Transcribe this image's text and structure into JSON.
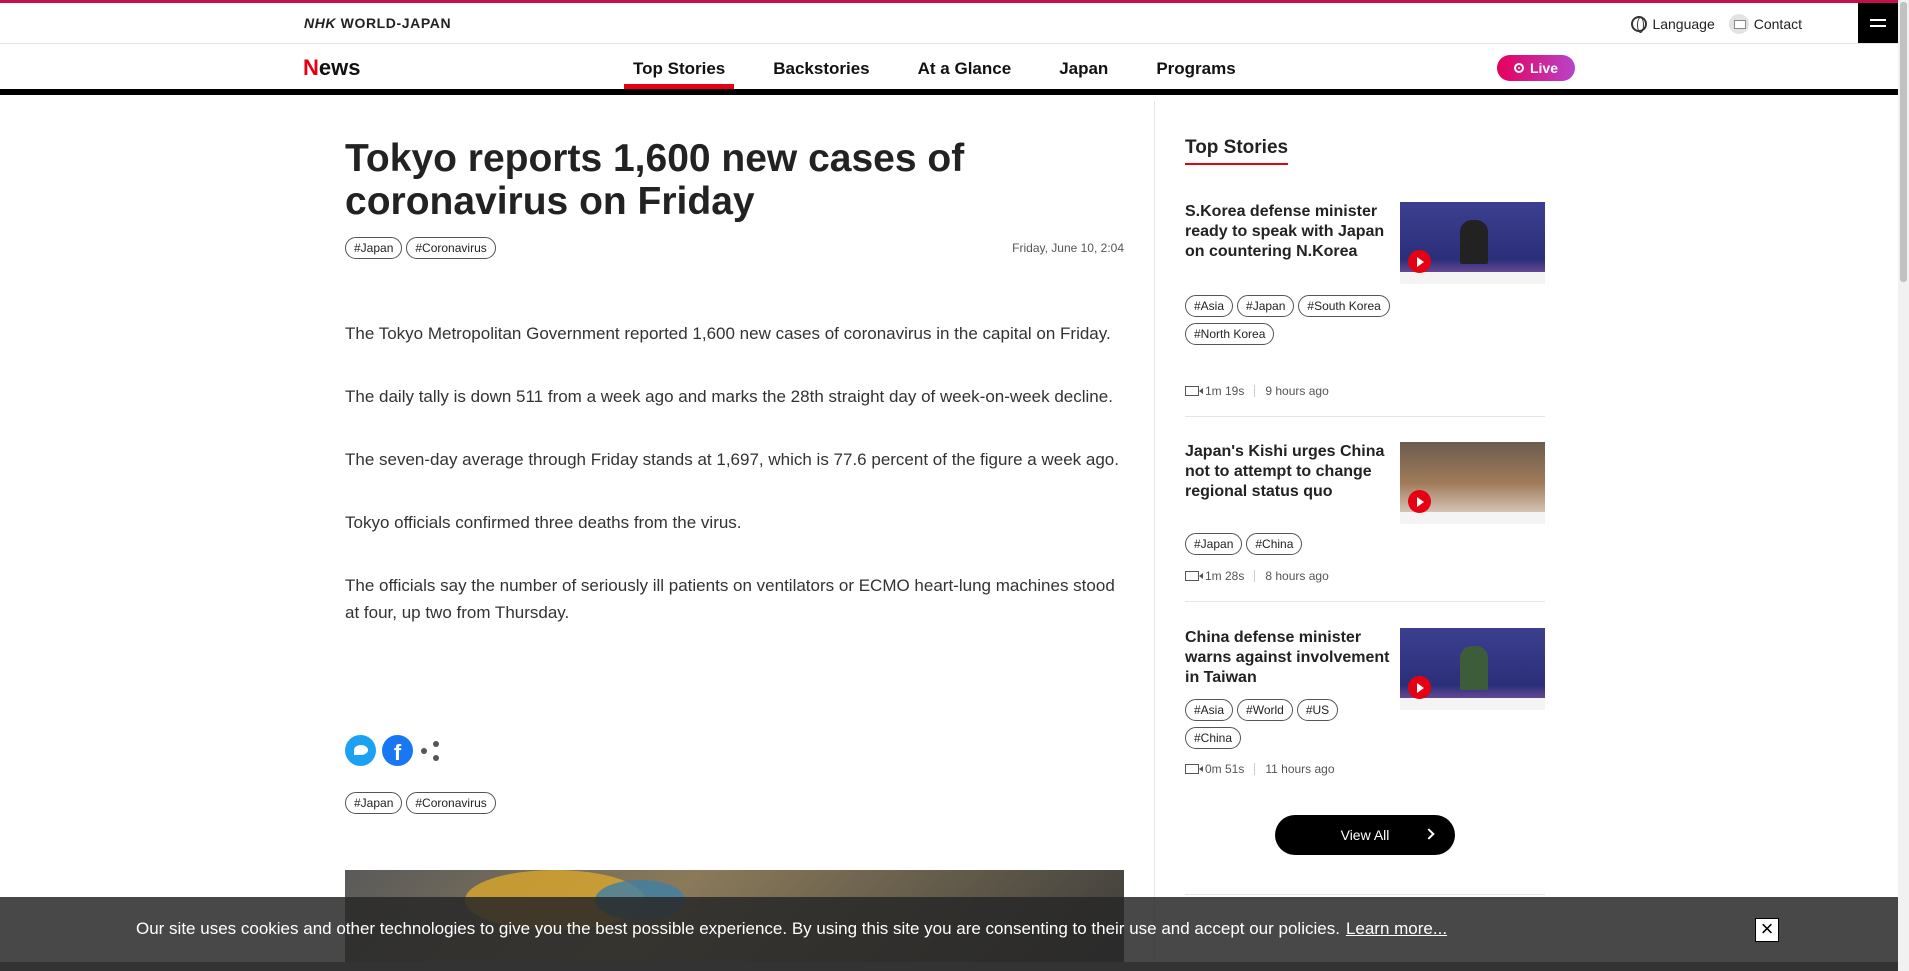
{
  "header": {
    "brand_nhk": "NHK",
    "brand_rest": "WORLD-JAPAN",
    "language_label": "Language",
    "contact_label": "Contact"
  },
  "nav": {
    "logo_n": "N",
    "logo_rest": "ews",
    "items": [
      "Top Stories",
      "Backstories",
      "At a Glance",
      "Japan",
      "Programs"
    ],
    "active": "Top Stories",
    "live_label": "Live"
  },
  "article": {
    "headline": "Tokyo reports 1,600 new cases of coronavirus on Friday",
    "tags": [
      "#Japan",
      "#Coronavirus"
    ],
    "date": "Friday, June 10, 2:04",
    "paragraphs": [
      "The Tokyo Metropolitan Government reported 1,600 new cases of coronavirus in the capital on Friday.",
      "The daily tally is down 511 from a week ago and marks the 28th straight day of week-on-week decline.",
      "The seven-day average through Friday stands at 1,697, which is 77.6 percent of the figure a week ago.",
      "Tokyo officials confirmed three deaths from the virus.",
      "The officials say the number of seriously ill patients on ventilators or ECMO heart-lung machines stood at four, up two from Thursday."
    ],
    "bottom_tags": [
      "#Japan",
      "#Coronavirus"
    ]
  },
  "sidebar": {
    "title": "Top Stories",
    "stories": [
      {
        "title": "S.Korea defense minister ready to speak with Japan on countering N.Korea",
        "tags": [
          "#Asia",
          "#Japan",
          "#South Korea",
          "#North Korea"
        ],
        "duration": "1m 19s",
        "ago": "9 hours ago"
      },
      {
        "title": "Japan's Kishi urges China not to attempt to change regional status quo",
        "tags": [
          "#Japan",
          "#China"
        ],
        "duration": "1m 28s",
        "ago": "8 hours ago"
      },
      {
        "title": "China defense minister warns against involvement in Taiwan",
        "tags": [
          "#Asia",
          "#World",
          "#US",
          "#China"
        ],
        "duration": "0m 51s",
        "ago": "11 hours ago"
      }
    ],
    "view_all_label": "View All"
  },
  "cookie": {
    "text": "Our site uses cookies and other technologies to give you the best possible experience. By using this site you are consenting to their use and accept our policies.",
    "link_label": "Learn more...",
    "close_symbol": "×"
  }
}
